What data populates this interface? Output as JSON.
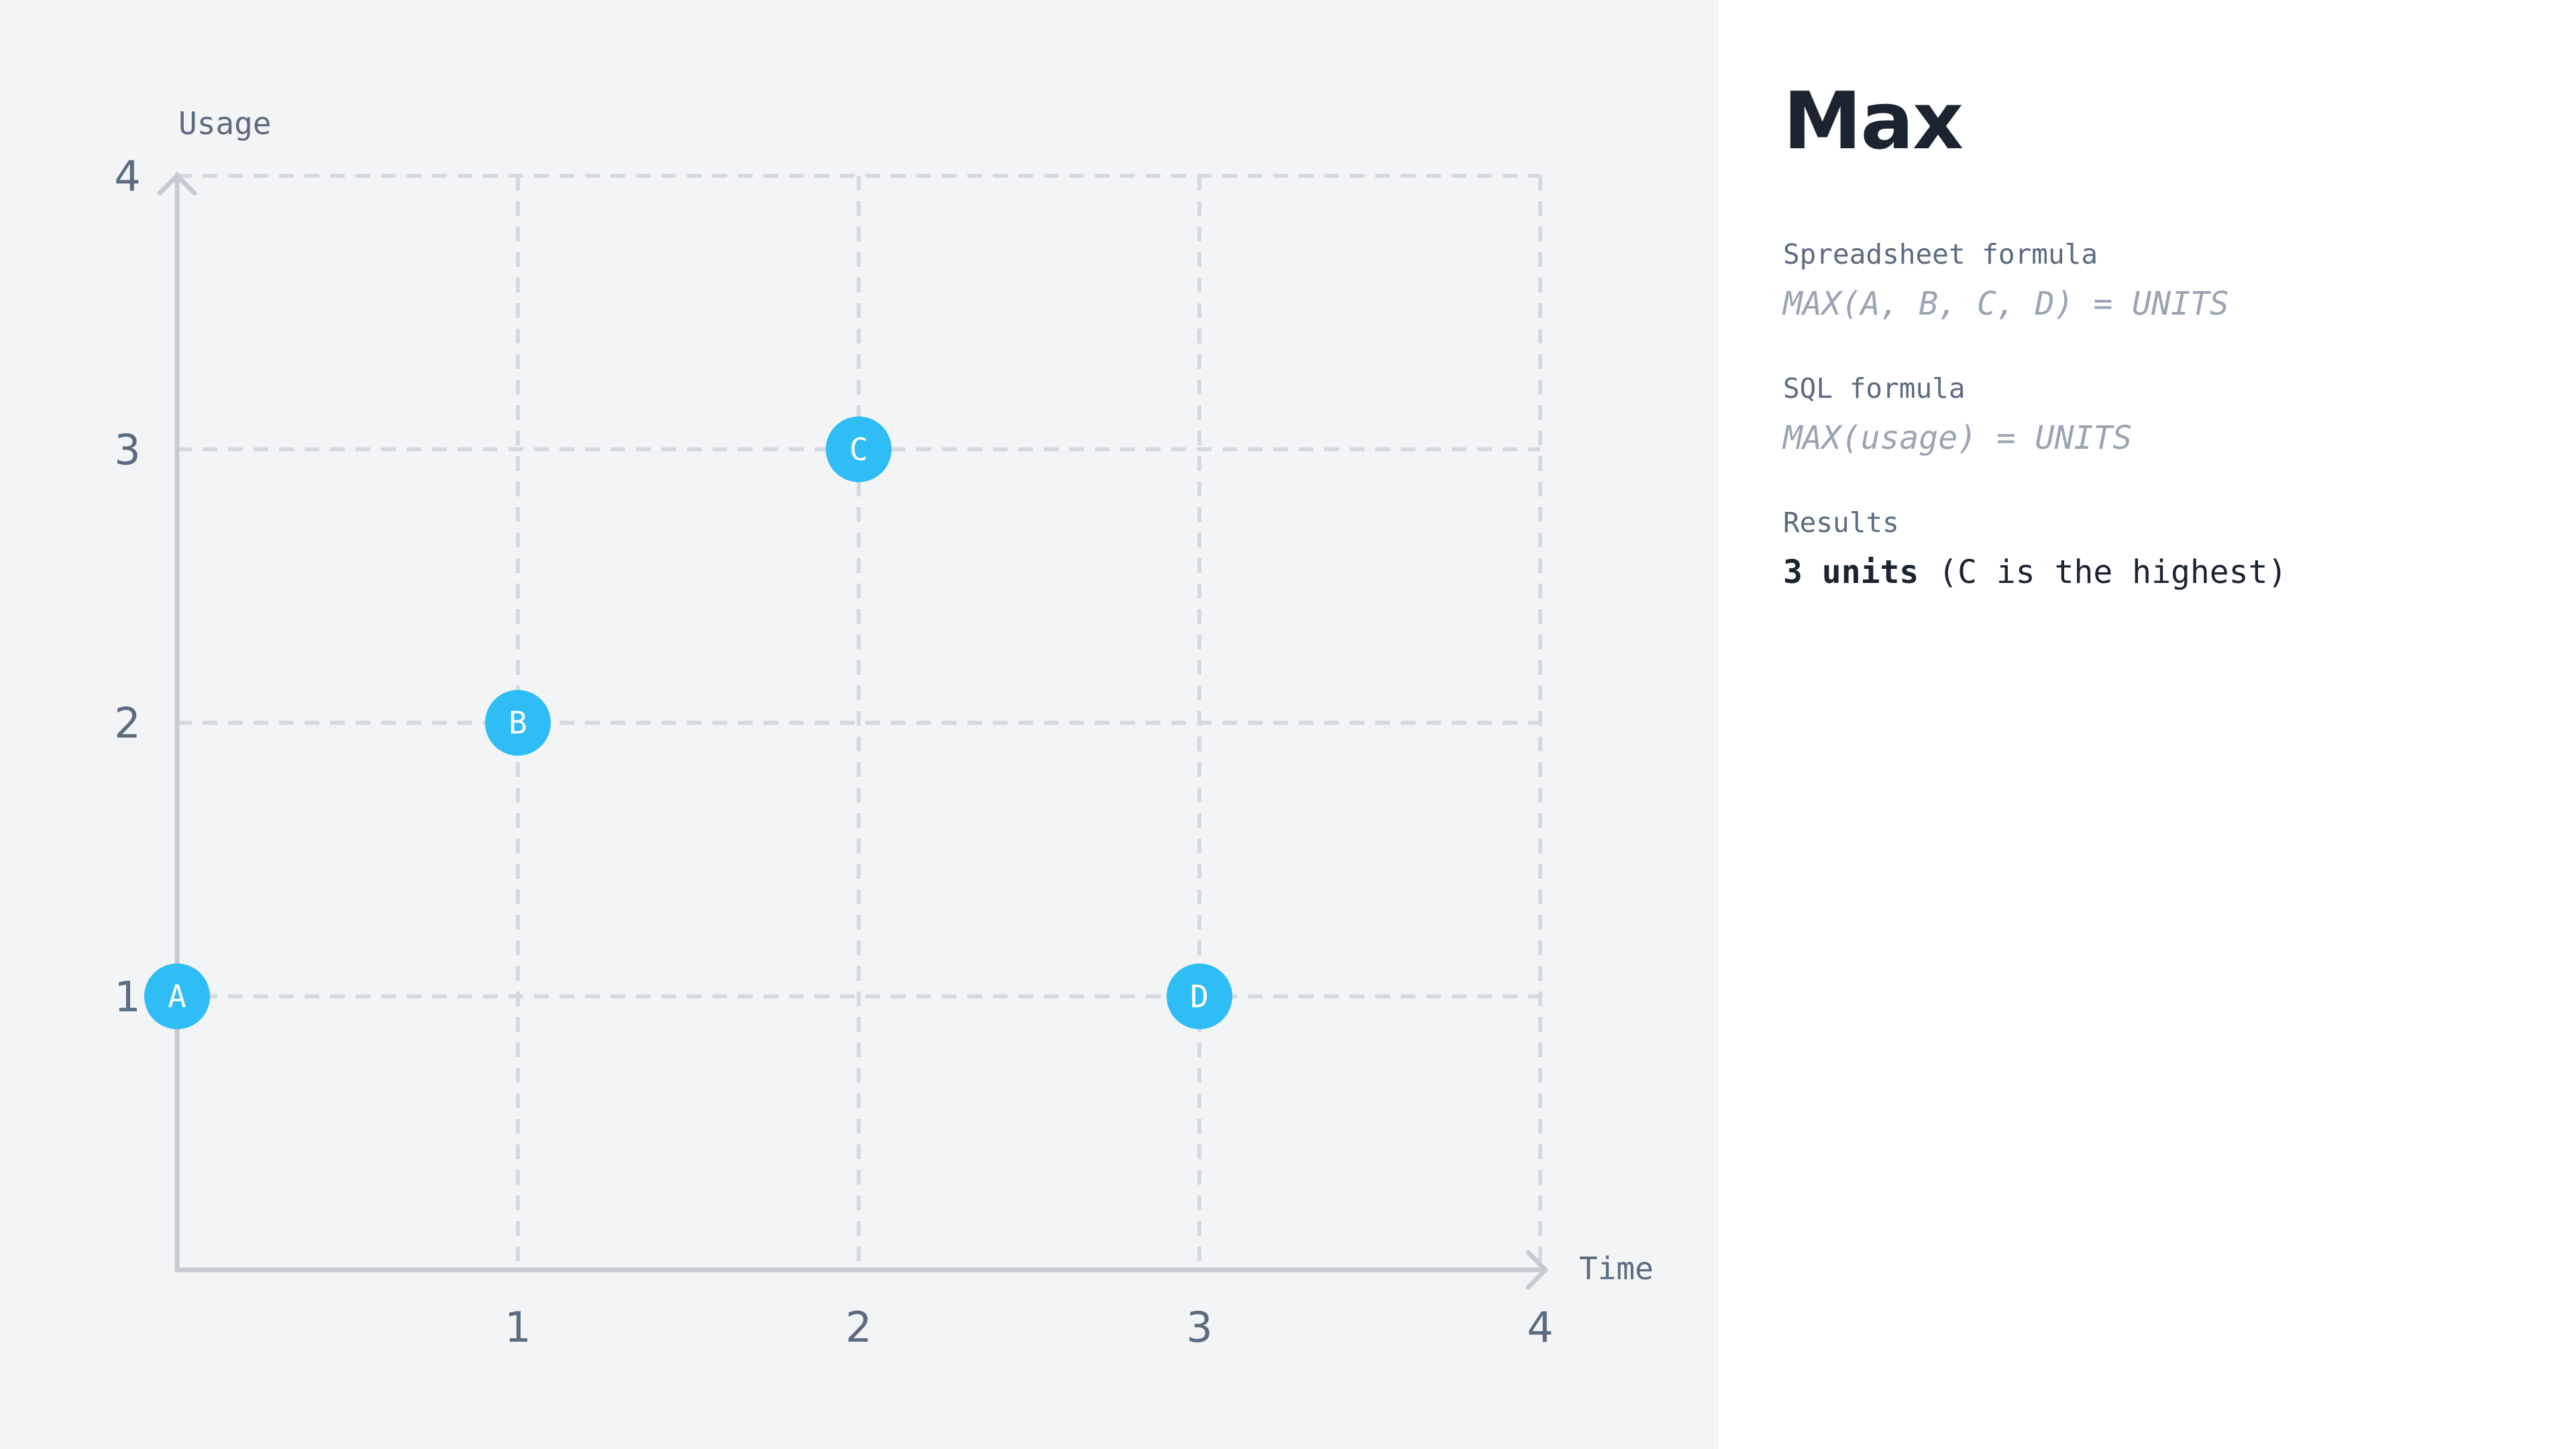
{
  "chart_data": {
    "type": "scatter",
    "xlabel": "Time",
    "ylabel": "Usage",
    "xlim": [
      0,
      4
    ],
    "ylim": [
      0,
      4
    ],
    "x_ticks": [
      1,
      2,
      3,
      4
    ],
    "y_ticks": [
      1,
      2,
      3,
      4
    ],
    "grid": true,
    "points": [
      {
        "label": "A",
        "x": 0,
        "y": 1
      },
      {
        "label": "B",
        "x": 1,
        "y": 2
      },
      {
        "label": "C",
        "x": 2,
        "y": 3
      },
      {
        "label": "D",
        "x": 3,
        "y": 1
      }
    ],
    "colors": {
      "point": "#2ebdf5",
      "point_label": "#ffffff",
      "axis": "#c5cad3",
      "grid": "#d4d8df",
      "tick_label": "#5b6b80"
    }
  },
  "info": {
    "title": "Max",
    "spreadsheet_label": "Spreadsheet formula",
    "spreadsheet_formula": "MAX(A, B, C, D) = UNITS",
    "sql_label": "SQL formula",
    "sql_formula": "MAX(usage) = UNITS",
    "results_label": "Results",
    "result_value": "3 units",
    "result_note": " (C is the highest)"
  }
}
